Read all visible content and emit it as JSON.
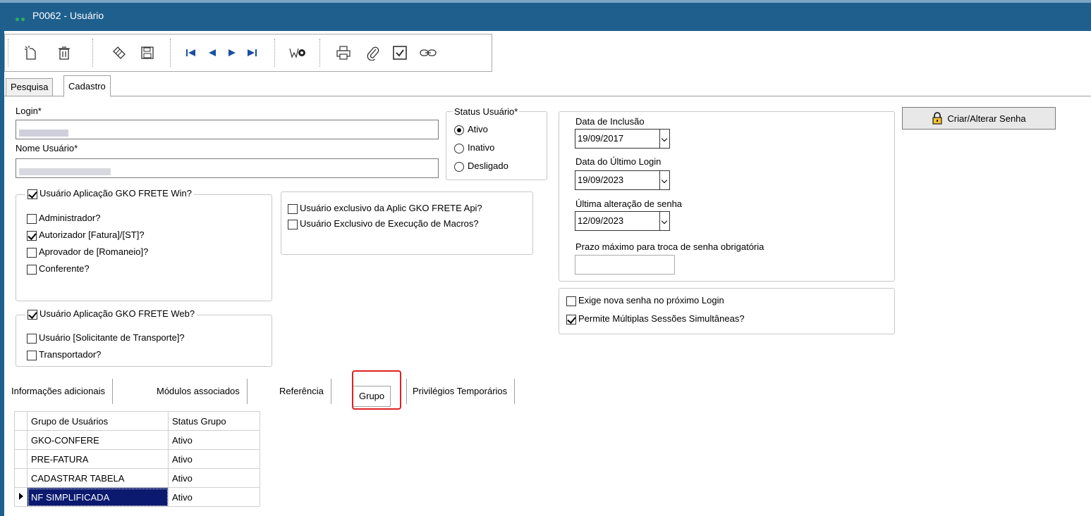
{
  "window": {
    "title": "P0062 - Usuário"
  },
  "toolbar": {
    "buttons": [
      {
        "icon": "new-document-icon"
      },
      {
        "icon": "trash-icon"
      },
      {
        "icon": "edit-icon"
      },
      {
        "icon": "save-icon"
      },
      {
        "icon": "first-record-icon"
      },
      {
        "icon": "previous-record-icon"
      },
      {
        "icon": "next-record-icon"
      },
      {
        "icon": "last-record-icon"
      },
      {
        "icon": "search-icon"
      },
      {
        "icon": "print-icon"
      },
      {
        "icon": "attach-icon"
      },
      {
        "icon": "check-icon"
      },
      {
        "icon": "link-icon"
      }
    ]
  },
  "tabs": [
    "Pesquisa",
    "Cadastro"
  ],
  "form": {
    "login_label": "Login*",
    "login_value": "",
    "nome_label": "Nome Usuário*",
    "nome_value": "",
    "status_label": "Status Usuário*",
    "status_options": [
      "Ativo",
      "Inativo",
      "Desligado"
    ],
    "status_selected": "Ativo",
    "win_group": {
      "label": "Usuário Aplicação GKO FRETE Win?",
      "checked": true,
      "items": [
        {
          "label": "Administrador?",
          "checked": false
        },
        {
          "label": "Autorizador [Fatura]/[ST]?",
          "checked": true
        },
        {
          "label": "Aprovador de [Romaneio]?",
          "checked": false
        },
        {
          "label": "Conferente?",
          "checked": false
        }
      ]
    },
    "web_group": {
      "label": "Usuário Aplicação GKO FRETE Web?",
      "checked": true,
      "items": [
        {
          "label": "Usuário [Solicitante de Transporte]?",
          "checked": false
        },
        {
          "label": "Transportador?",
          "checked": false
        }
      ]
    },
    "exclusive": [
      {
        "label": "Usuário exclusivo da Aplic GKO FRETE Api?",
        "checked": false
      },
      {
        "label": "Usuário Exclusivo de Execução de Macros?",
        "checked": false
      }
    ],
    "data_inclusao_label": "Data de Inclusão",
    "data_inclusao": "19/09/2017",
    "ultimo_login_label": "Data do Último Login",
    "ultimo_login": "19/09/2023",
    "alteracao_senha_label": "Última alteração de senha",
    "alteracao_senha": "12/09/2023",
    "prazo_label": "Prazo máximo para troca de senha obrigatória",
    "prazo_value": "",
    "options": [
      {
        "label": "Exige nova senha no próximo Login",
        "checked": false
      },
      {
        "label": "Permite Múltiplas Sessões Simultâneas?",
        "checked": true
      }
    ],
    "senha_button": "Criar/Alterar Senha"
  },
  "subtabs": [
    "Informações adicionais",
    "Módulos associados",
    "Referência",
    "Grupo",
    "Privilégios Temporários"
  ],
  "grid": {
    "headers": [
      "Grupo de Usuários",
      "Status Grupo"
    ],
    "rows": [
      [
        "GKO-CONFERE",
        "Ativo"
      ],
      [
        "PRE-FATURA",
        "Ativo"
      ],
      [
        "CADASTRAR TABELA",
        "Ativo"
      ],
      [
        "NF SIMPLIFICADA",
        "Ativo"
      ]
    ]
  }
}
